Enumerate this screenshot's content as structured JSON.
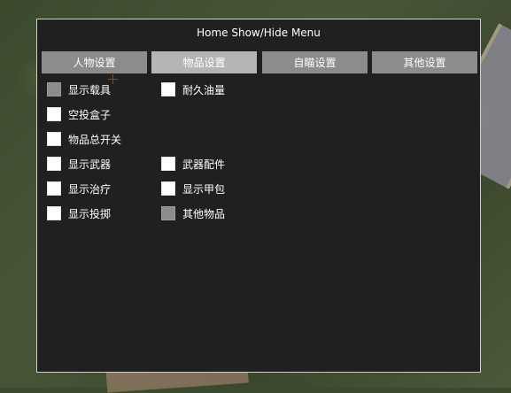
{
  "window": {
    "title": "Home Show/Hide Menu"
  },
  "tabs": [
    {
      "label": "人物设置",
      "active": false
    },
    {
      "label": "物品设置",
      "active": true
    },
    {
      "label": "自瞄设置",
      "active": false
    },
    {
      "label": "其他设置",
      "active": false
    }
  ],
  "options": {
    "show_vehicles": {
      "label": "显示载具",
      "checked": true
    },
    "durability_fuel": {
      "label": "耐久油量",
      "checked": false
    },
    "airdrop_box": {
      "label": "空投盒子",
      "checked": false
    },
    "items_master": {
      "label": "物品总开关",
      "checked": false
    },
    "show_weapons": {
      "label": "显示武器",
      "checked": false
    },
    "weapon_attachments": {
      "label": "武器配件",
      "checked": false
    },
    "show_healing": {
      "label": "显示治疗",
      "checked": false
    },
    "show_armor": {
      "label": "显示甲包",
      "checked": false
    },
    "show_throwables": {
      "label": "显示投掷",
      "checked": false
    },
    "other_items": {
      "label": "其他物品",
      "checked": true
    }
  },
  "colors": {
    "panel_bg": "#202020",
    "tab_bg": "#8c8c8c",
    "tab_active_bg": "#b5b5b5",
    "checkbox_unchecked": "#ffffff",
    "checkbox_checked": "#8c8c8c",
    "cursor": "#e02020"
  }
}
